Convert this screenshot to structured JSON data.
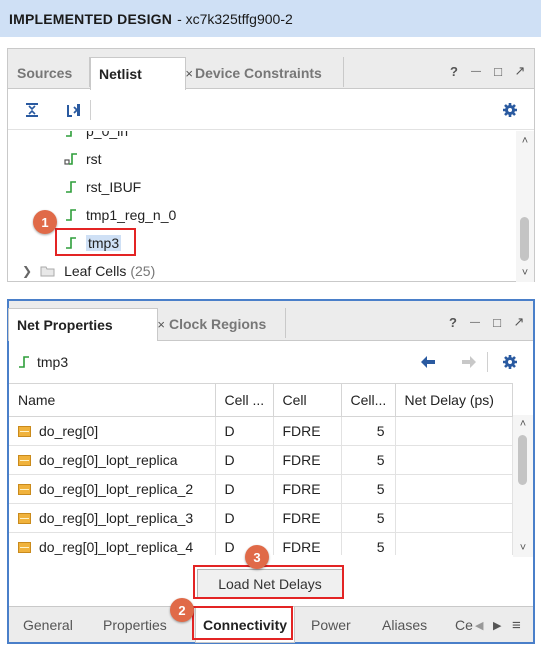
{
  "title_bar": {
    "title": "IMPLEMENTED DESIGN",
    "subtitle": "- xc7k325tffg900-2"
  },
  "netlist_panel": {
    "tabs": [
      {
        "label": "Sources",
        "active": false
      },
      {
        "label": "Netlist",
        "active": true
      },
      {
        "label": "Device Constraints",
        "active": false
      }
    ],
    "close_glyph": "×",
    "window_controls": [
      "?",
      "—",
      "□",
      "↗"
    ],
    "toolbar_icons": [
      "collapse-all-icon",
      "expand-all-icon",
      "settings-icon"
    ],
    "tree_items": [
      {
        "label": "p_0_in",
        "icon": "net-icon"
      },
      {
        "label": "rst",
        "icon": "net-pin-icon"
      },
      {
        "label": "rst_IBUF",
        "icon": "net-icon"
      },
      {
        "label": "tmp1_reg_n_0",
        "icon": "net-icon"
      },
      {
        "label": "tmp3",
        "icon": "net-icon",
        "selected": true
      }
    ],
    "leaf_cells": {
      "label": "Leaf Cells",
      "count": "(25)"
    }
  },
  "net_properties_panel": {
    "tabs": [
      {
        "label": "Net Properties",
        "active": true
      },
      {
        "label": "Clock Regions",
        "active": false
      }
    ],
    "close_glyph": "×",
    "net_name": "tmp3",
    "columns": [
      "Name",
      "Cell ...",
      "Cell",
      "Cell...",
      "Net Delay (ps)"
    ],
    "rows": [
      {
        "name": "do_reg[0]",
        "pin": "D",
        "cell": "FDRE",
        "count": "5",
        "delay": ""
      },
      {
        "name": "do_reg[0]_lopt_replica",
        "pin": "D",
        "cell": "FDRE",
        "count": "5",
        "delay": ""
      },
      {
        "name": "do_reg[0]_lopt_replica_2",
        "pin": "D",
        "cell": "FDRE",
        "count": "5",
        "delay": ""
      },
      {
        "name": "do_reg[0]_lopt_replica_3",
        "pin": "D",
        "cell": "FDRE",
        "count": "5",
        "delay": ""
      },
      {
        "name": "do_reg[0]_lopt_replica_4",
        "pin": "D",
        "cell": "FDRE",
        "count": "5",
        "delay": ""
      }
    ],
    "load_button": "Load Net Delays",
    "bottom_tabs": [
      "General",
      "Properties",
      "Connectivity",
      "Power",
      "Aliases",
      "Ce"
    ],
    "active_bottom_tab": "Connectivity"
  },
  "callouts": [
    "1",
    "2",
    "3"
  ],
  "colors": {
    "title_bg": "#cfe0f5",
    "panel_border_active": "#4a7fc9",
    "callout_red": "#e32424",
    "callout_badge": "#e06a48",
    "net_green": "#2e9e3a",
    "register_orange": "#f0b23c",
    "arrow_blue": "#2a5aa0"
  }
}
